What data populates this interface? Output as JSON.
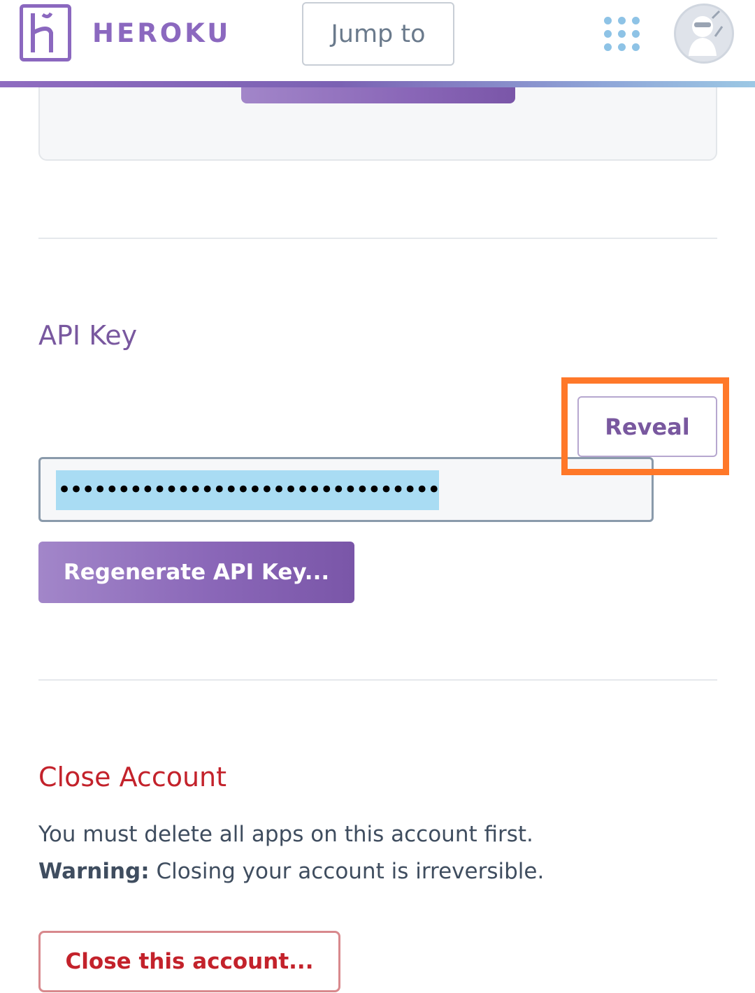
{
  "header": {
    "brand": "HEROKU",
    "jump_placeholder": "Jump to",
    "logo_icon": "heroku-logo-icon",
    "apps_icon": "apps-grid-icon",
    "avatar_icon": "ninja-avatar-icon"
  },
  "api_key": {
    "heading": "API Key",
    "reveal_label": "Reveal",
    "masked_value": "••••••••••••••••••••••••••••••••",
    "regenerate_label": "Regenerate API Key..."
  },
  "close_account": {
    "heading": "Close Account",
    "line1": "You must delete all apps on this account first.",
    "warning_label": "Warning:",
    "warning_text": " Closing your account is irreversible.",
    "button_label": "Close this account..."
  },
  "colors": {
    "brand_purple": "#79589f",
    "danger_red": "#c3222b",
    "highlight_orange": "#ff7829",
    "selection_blue": "#a9dcf3"
  }
}
